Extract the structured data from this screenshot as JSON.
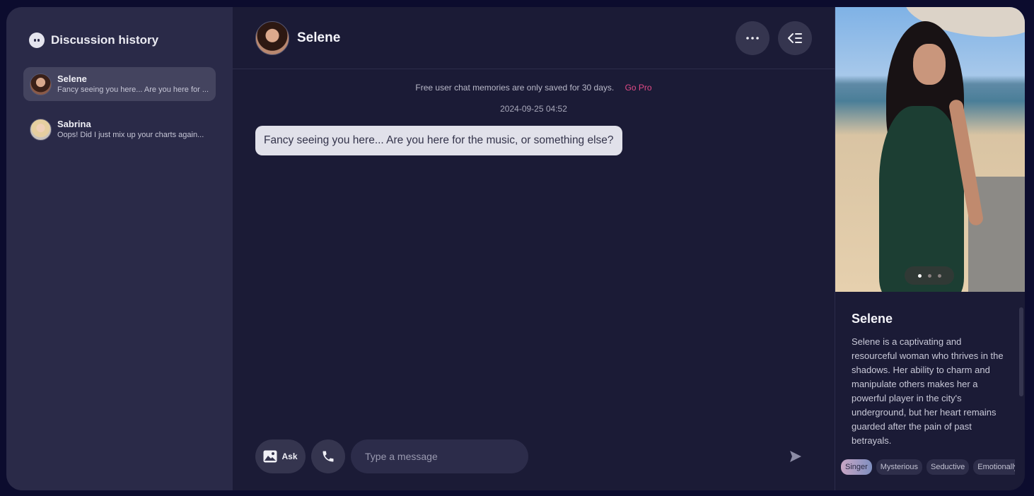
{
  "sidebar": {
    "title": "Discussion history",
    "conversations": [
      {
        "name": "Selene",
        "preview": "Fancy seeing you here... Are you here for ..."
      },
      {
        "name": "Sabrina",
        "preview": "Oops! Did I just mix up your charts again..."
      }
    ]
  },
  "chat": {
    "header": {
      "name": "Selene"
    },
    "notice": {
      "text": "Free user chat memories are only saved for 30 days.",
      "link": "Go Pro"
    },
    "timestamp": "2024-09-25 04:52",
    "messages": [
      {
        "text": "Fancy seeing you here... Are you here for the music, or something else?"
      }
    ],
    "composer": {
      "ask_label": "Ask",
      "placeholder": "Type a message"
    }
  },
  "profile": {
    "name": "Selene",
    "description": "Selene is a captivating and resourceful woman who thrives in the shadows. Her ability to charm and manipulate others makes her a powerful player in the city's underground, but her heart remains guarded after the pain of past betrayals.",
    "tags": [
      "Singer",
      "Mysterious",
      "Seductive",
      "Emotionally"
    ],
    "carousel": {
      "count": 3,
      "active_index": 0
    }
  },
  "colors": {
    "background": "#0c0c2e",
    "sidebar": "#2a2a48",
    "main": "#1b1b36",
    "accent_link": "#e04a86",
    "bubble": "#e1e1ea"
  }
}
